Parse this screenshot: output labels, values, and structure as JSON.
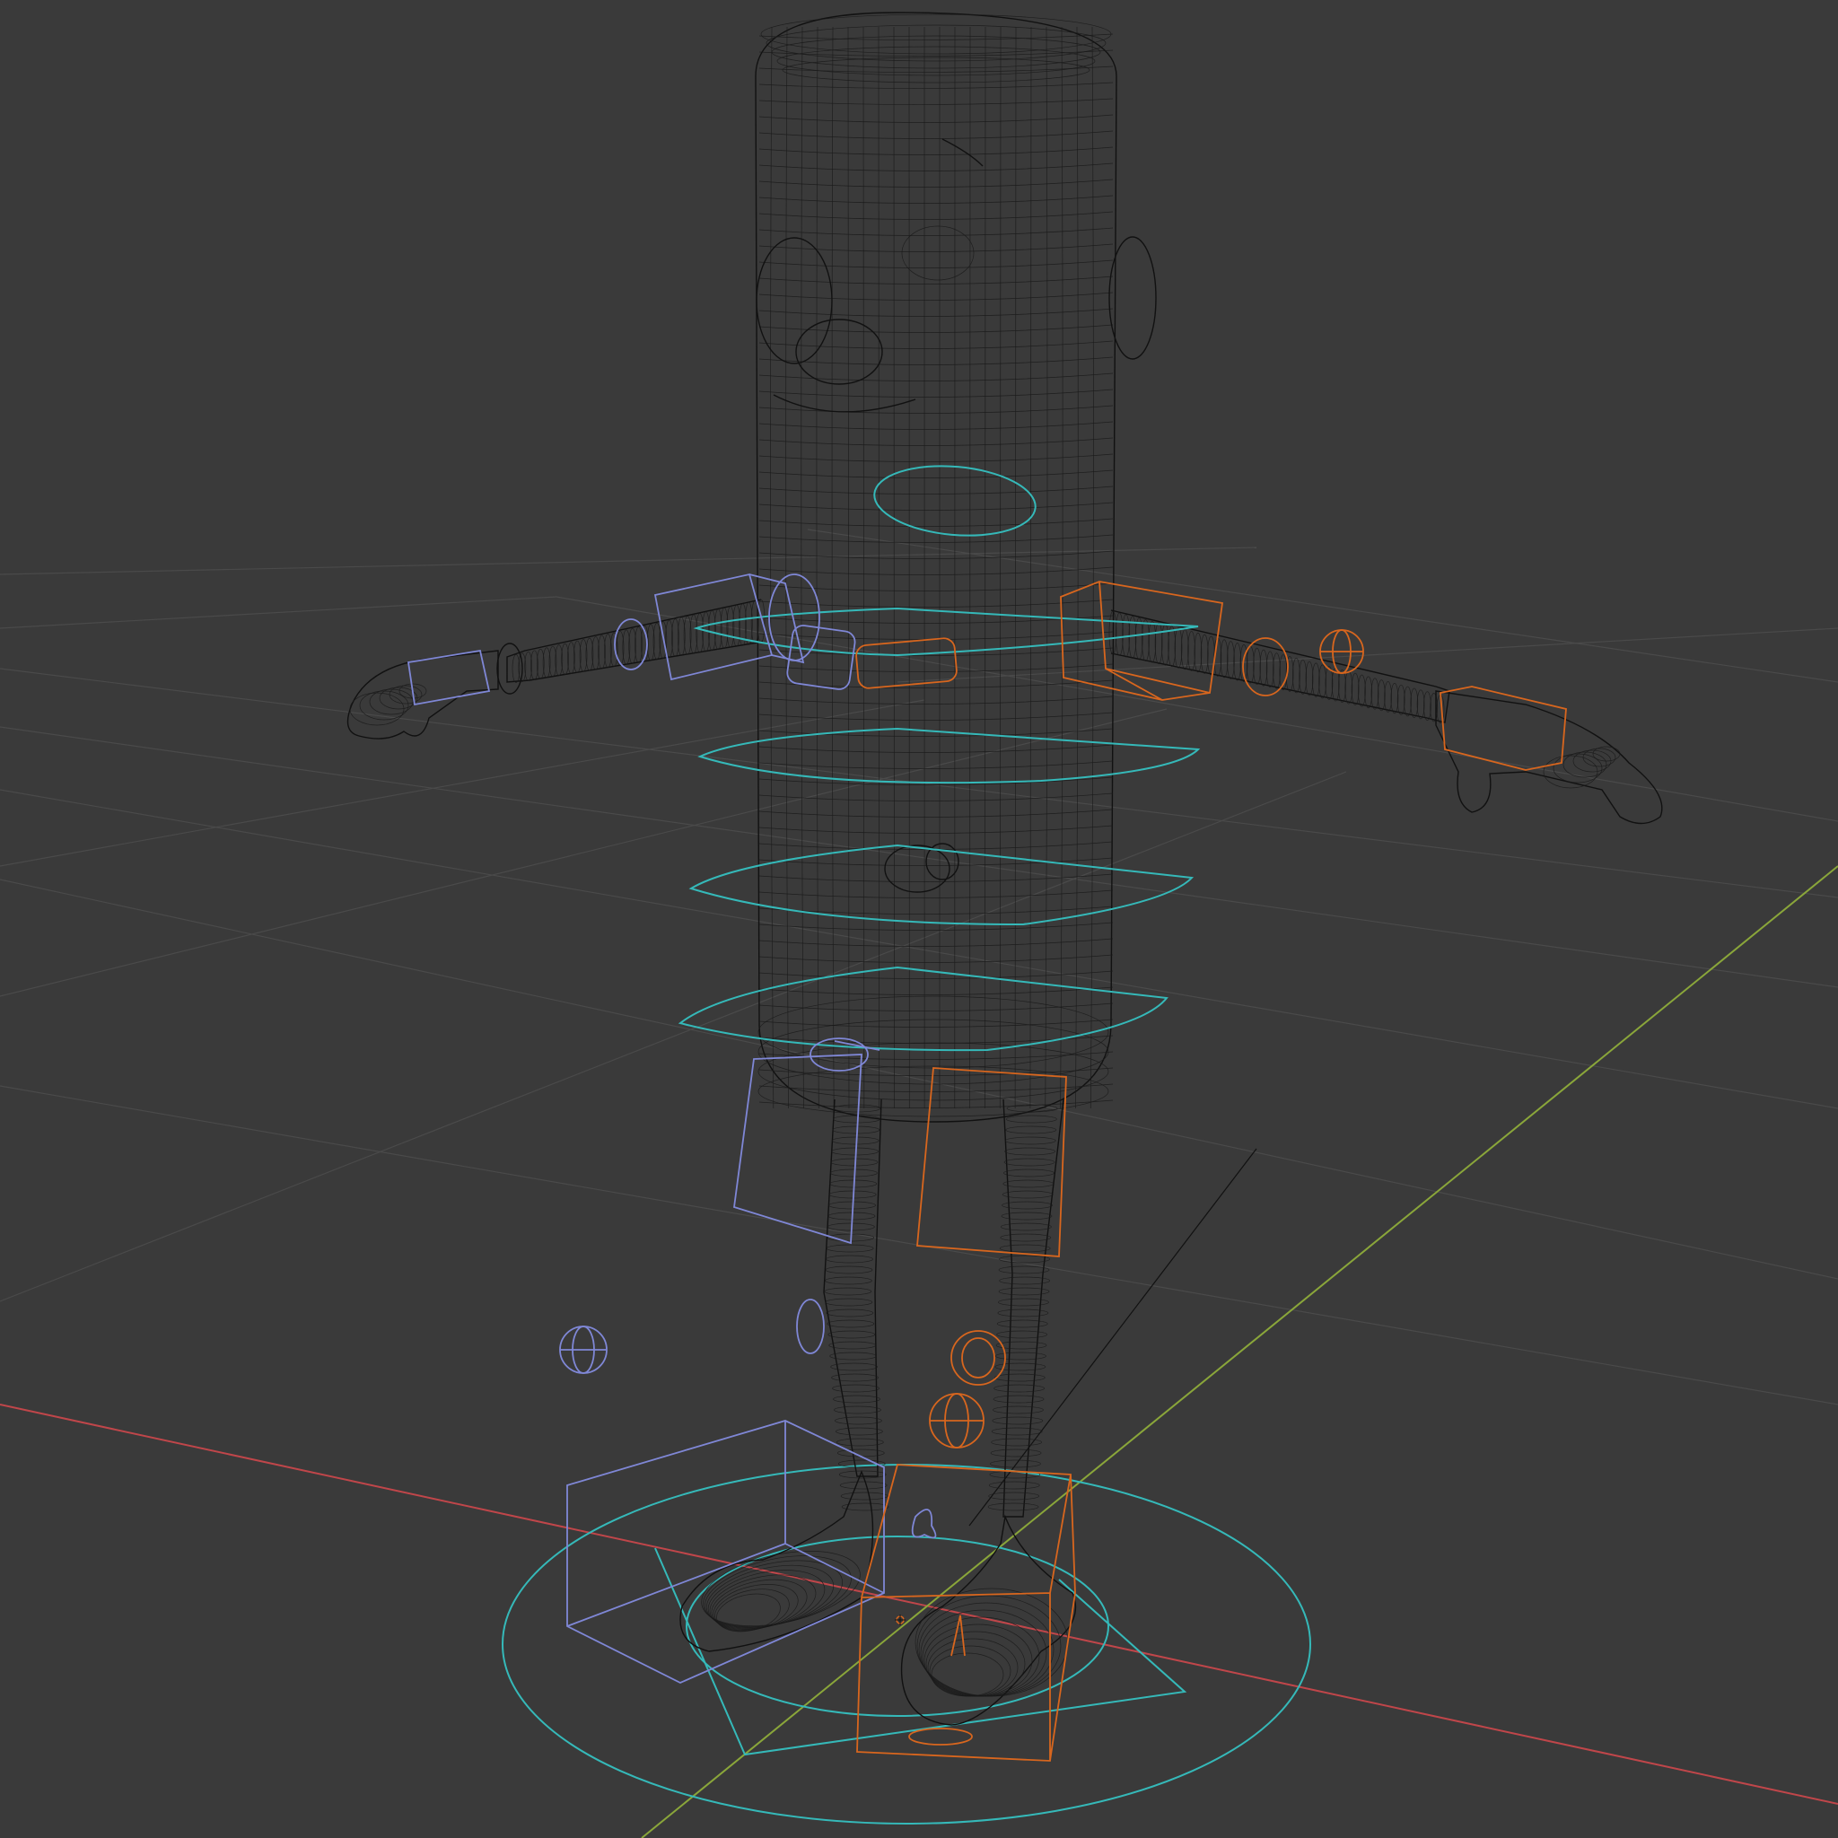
{
  "viewport": {
    "shading_mode": "wireframe",
    "background_color": "#3a3a3a",
    "grid_color": "#4a4a4a",
    "mesh_wire_color": "#111111"
  },
  "axes": {
    "x_axis_color": "#c0464a",
    "y_axis_color": "#8aa63a"
  },
  "rig_controls": {
    "center_color": "#35b9b9",
    "left_side_color": "#7f87d6",
    "right_side_color": "#d8661e"
  },
  "icons": {
    "character": "wireframe-character-icon",
    "origin": "origin-icon"
  }
}
